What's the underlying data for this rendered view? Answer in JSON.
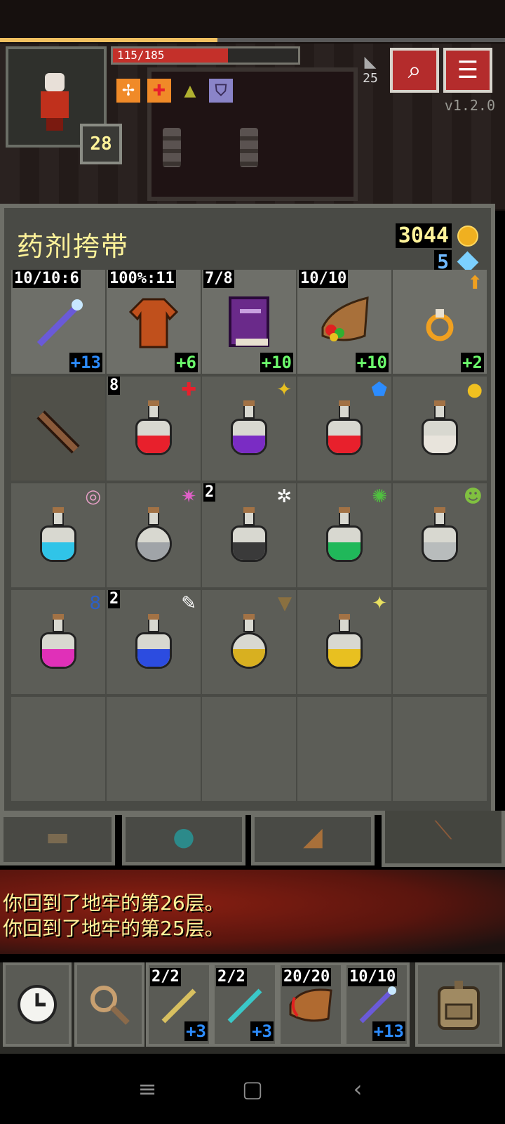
{
  "hud": {
    "hp_text": "115/185",
    "hp_fraction": 0.62,
    "xp_fraction": 0.43,
    "hero_level": "28",
    "depth": "25",
    "version": "v1.2.0",
    "buff_icons": [
      "bless-icon",
      "healing-icon",
      "bell-icon",
      "shield-icon"
    ],
    "top_buttons": [
      "journal-button",
      "menu-button"
    ]
  },
  "inventory": {
    "title": "药剂挎带",
    "gold": "3044",
    "gems": "5",
    "equipped": [
      {
        "name": "wand-slot",
        "top": "10/10:6",
        "bottom": "+13"
      },
      {
        "name": "armor-slot",
        "top": "100%:11",
        "bottom": "+6"
      },
      {
        "name": "spellbook-slot",
        "top": "7/8",
        "bottom": "+10"
      },
      {
        "name": "horn-of-plenty-slot",
        "top": "10/10",
        "bottom": "+10"
      },
      {
        "name": "ring-slot",
        "top": "",
        "bottom": "+2"
      }
    ],
    "potions": [
      {
        "name": "potion-healing",
        "qty": "8",
        "color": "#e8202c",
        "mark": "✚",
        "mark_color": "#e8202c"
      },
      {
        "name": "potion-haste",
        "qty": "",
        "color": "#7a2cc4",
        "mark": "✦",
        "mark_color": "#e8c020"
      },
      {
        "name": "potion-shielding",
        "qty": "",
        "color": "#e8202c",
        "mark": "⬟",
        "mark_color": "#2c8cff"
      },
      {
        "name": "potion-liquid-flame",
        "qty": "",
        "color": "#e8e4dc",
        "mark": "●",
        "mark_color": "#f0c020"
      },
      {
        "name": "potion-mind-vision",
        "qty": "",
        "color": "#30c4e8",
        "mark": "◎",
        "mark_color": "#e8a0c8"
      },
      {
        "name": "potion-purity",
        "qty": "",
        "color": "#a0a4a8",
        "mark": "✷",
        "mark_color": "#e060c8"
      },
      {
        "name": "potion-frost",
        "qty": "2",
        "color": "#3a3a3a",
        "mark": "✲",
        "mark_color": "#ffffff"
      },
      {
        "name": "potion-toxic-gas",
        "qty": "",
        "color": "#20b85a",
        "mark": "✺",
        "mark_color": "#50c040"
      },
      {
        "name": "potion-paralytic-gas",
        "qty": "",
        "color": "#b8bcbc",
        "mark": "☻",
        "mark_color": "#80c040"
      },
      {
        "name": "potion-experience",
        "qty": "",
        "color": "#e030b8",
        "mark": "8",
        "mark_color": "#2c60c8"
      },
      {
        "name": "potion-levitation",
        "qty": "2",
        "color": "#2c4ce0",
        "mark": "✎",
        "mark_color": "#ffffff"
      },
      {
        "name": "potion-strength",
        "qty": "",
        "color": "#d8b020",
        "mark": "▼",
        "mark_color": "#8a7040"
      },
      {
        "name": "potion-invisibility",
        "qty": "",
        "color": "#e8c020",
        "mark": "✦",
        "mark_color": "#e8e060"
      }
    ]
  },
  "log": {
    "line1": "你回到了地牢的第26层。",
    "line2": "你回到了地牢的第25层。"
  },
  "quickslots": [
    {
      "name": "quickslot-wand-1",
      "top": "2/2",
      "bottom": "+3"
    },
    {
      "name": "quickslot-wand-2",
      "top": "2/2",
      "bottom": "+3"
    },
    {
      "name": "quickslot-horn",
      "top": "20/20",
      "bottom": ""
    },
    {
      "name": "quickslot-wand-3",
      "top": "10/10",
      "bottom": "+13"
    }
  ]
}
